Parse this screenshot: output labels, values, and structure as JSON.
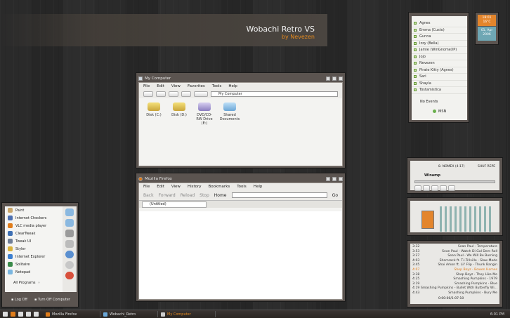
{
  "banner": {
    "title": "Wobachi Retro VS",
    "subtitle": "by Nevezen"
  },
  "mycomputer": {
    "title": "My Computer",
    "menu": [
      "File",
      "Edit",
      "View",
      "Favorites",
      "Tools",
      "Help"
    ],
    "address": "My Computer",
    "drives": [
      {
        "label": "Disk (C:)",
        "icon": "hard-disk-icon"
      },
      {
        "label": "Disk (D:)",
        "icon": "hard-disk-icon"
      },
      {
        "label": "DVD/CD-RW Drive (E:)",
        "icon": "dvd-drive-icon"
      },
      {
        "label": "Shared Documents",
        "icon": "folder-icon"
      }
    ]
  },
  "firefox": {
    "title": "Mozilla Firefox",
    "menu": [
      "File",
      "Edit",
      "View",
      "History",
      "Bookmarks",
      "Tools",
      "Help"
    ],
    "nav": [
      "Back",
      "Forward",
      "Reload",
      "Stop",
      "Home"
    ],
    "go_label": "Go",
    "tab_label": "(Untitled)"
  },
  "startmenu": {
    "items": [
      "Paint",
      "Internet Checkers",
      "VLC media player",
      "ClearTweak",
      "Tweak UI",
      "Styler",
      "Internet Explorer",
      "Solitaire",
      "Notepad"
    ],
    "all_programs": "All Programs",
    "log_off": "Log Off",
    "turn_off": "Turn Off Computer"
  },
  "taskbar": {
    "tasks": [
      "Mozilla Firefox",
      "Wobachi_Retro",
      "My Computer"
    ],
    "clock": "6:01 PM"
  },
  "buddies": {
    "names": [
      "Agnes",
      "Emma (Custo)",
      "Gunna",
      "Izzy (Bella)",
      "Jamie (WinGnomeXP)",
      "Jojo",
      "Nevezen",
      "Pirate Kitty (Agnes)",
      "Sari",
      "Shayla",
      "Tostamistica"
    ],
    "no_events": "No Events",
    "msn": "MSN"
  },
  "clockwidget": {
    "time": "18:01",
    "temp": "16°C",
    "date": "01, Apr",
    "year": "2006"
  },
  "winamp": {
    "title_text": "8. NOMEX (4:17)",
    "mode": "SHUF REPE",
    "brand": "Winamp"
  },
  "playlist": [
    {
      "time": "3:32",
      "track": "Sean Paul - Temperature"
    },
    {
      "time": "3:53",
      "track": "Sean Paul - Watch Di Gal Dem Roll"
    },
    {
      "time": "3:27",
      "track": "Sean Paul - We Will Be Burning"
    },
    {
      "time": "4:03",
      "track": "Shamrock ft. T.I.Trilville - Slow Mode"
    },
    {
      "time": "3:45",
      "track": "Shai Arkon ft. Lil' Flip - Thunk Bangin"
    },
    {
      "time": "4:07",
      "track": "Shop Boyz - Bowen Homes"
    },
    {
      "time": "3:38",
      "track": "Shop Boyz - They Like Me"
    },
    {
      "time": "4:25",
      "track": "Smashing Pumpkins - 1979"
    },
    {
      "time": "3:19",
      "track": "Smashing Pumpkins - Blue"
    },
    {
      "time": "4:19",
      "track": "Smashing Pumpkins - Bullet With Butterfly Wi..."
    },
    {
      "time": "4:43",
      "track": "Smashing Pumpkins - Bury Me"
    }
  ],
  "playlist_footer": "0:00:00/1:07:10"
}
